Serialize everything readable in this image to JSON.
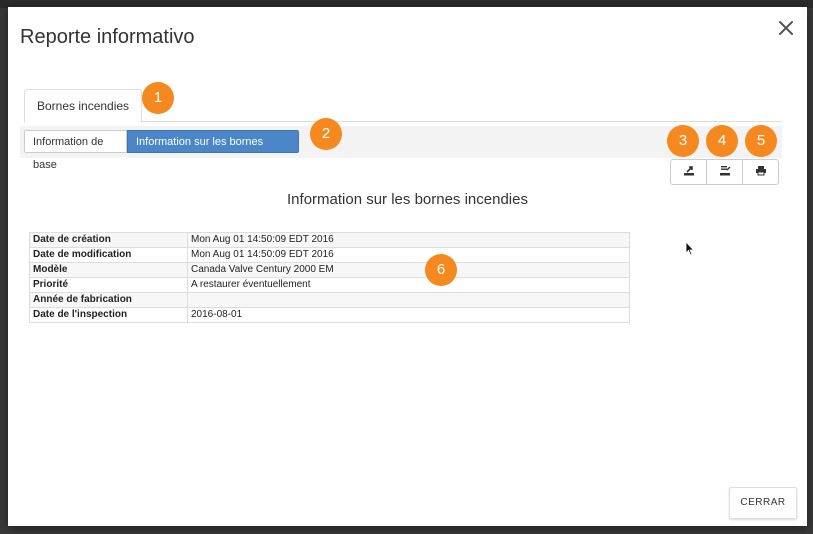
{
  "modal": {
    "title": "Reporte informativo",
    "close_icon": "close-icon"
  },
  "tabs": [
    {
      "label": "Bornes incendies",
      "active": true
    }
  ],
  "subtabs": [
    {
      "label": "Information de base",
      "active": false
    },
    {
      "label": "Information sur les bornes incendies",
      "active": true
    }
  ],
  "markers": [
    "1",
    "2",
    "3",
    "4",
    "5",
    "6"
  ],
  "toolbar": {
    "buttons": [
      {
        "icon": "export-icon"
      },
      {
        "icon": "export-list-icon"
      },
      {
        "icon": "print-icon"
      }
    ]
  },
  "section": {
    "title": "Information sur les bornes incendies"
  },
  "table": {
    "rows": [
      {
        "label": "Date de création",
        "value": "Mon Aug 01 14:50:09 EDT 2016"
      },
      {
        "label": "Date de modification",
        "value": "Mon Aug 01 14:50:09 EDT 2016"
      },
      {
        "label": "Modèle",
        "value": "Canada Valve Century 2000 EM"
      },
      {
        "label": "Priorité",
        "value": "A restaurer éventuellement"
      },
      {
        "label": "Année de fabrication",
        "value": ""
      },
      {
        "label": "Date de l'inspection",
        "value": "2016-08-01"
      }
    ]
  },
  "footer": {
    "close_label": "CERRAR"
  },
  "colors": {
    "accent_marker": "#f5891f",
    "active_segment": "#4a86c8"
  }
}
